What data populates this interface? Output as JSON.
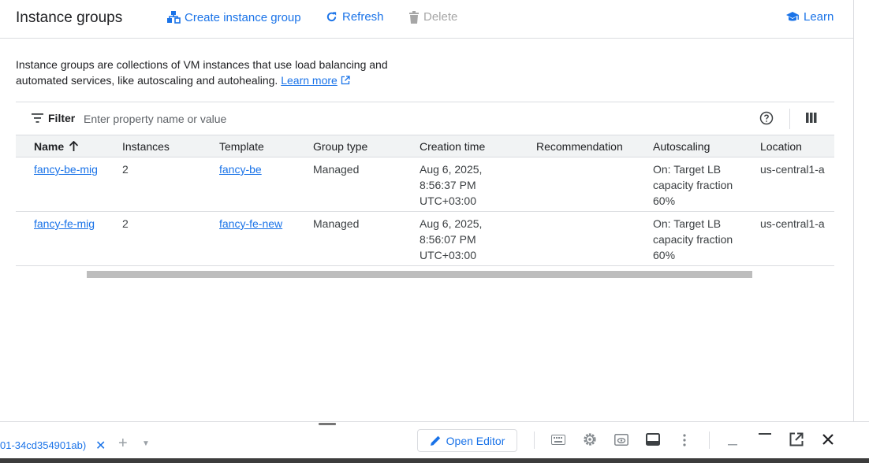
{
  "header": {
    "title": "Instance groups",
    "create_label": "Create instance group",
    "refresh_label": "Refresh",
    "delete_label": "Delete",
    "learn_label": "Learn"
  },
  "description": {
    "text": "Instance groups are collections of VM instances that use load balancing and automated services, like autoscaling and autohealing.",
    "learn_more": "Learn more"
  },
  "filter": {
    "label": "Filter",
    "placeholder": "Enter property name or value"
  },
  "table": {
    "columns": [
      "Name",
      "Instances",
      "Template",
      "Group type",
      "Creation time",
      "Recommendation",
      "Autoscaling",
      "Location"
    ],
    "rows": [
      {
        "name": "fancy-be-mig",
        "instances": "2",
        "template": "fancy-be",
        "group_type": "Managed",
        "creation_1": "Aug 6, 2025,",
        "creation_2": "8:56:37 PM",
        "creation_3": "UTC+03:00",
        "recommendation": "",
        "autoscaling_1": "On: Target LB",
        "autoscaling_2": "capacity fraction",
        "autoscaling_3": "60%",
        "location": "us-central1-a"
      },
      {
        "name": "fancy-fe-mig",
        "instances": "2",
        "template": "fancy-fe-new",
        "group_type": "Managed",
        "creation_1": "Aug 6, 2025,",
        "creation_2": "8:56:07 PM",
        "creation_3": "UTC+03:00",
        "recommendation": "",
        "autoscaling_1": "On: Target LB",
        "autoscaling_2": "capacity fraction",
        "autoscaling_3": "60%",
        "location": "us-central1-a"
      }
    ]
  },
  "shell": {
    "tab_label": "01-34cd354901ab)",
    "close_glyph": "✕",
    "plus_glyph": "+",
    "caret_glyph": "▼",
    "open_editor_label": "Open Editor"
  },
  "colors": {
    "accent": "#1a73e8",
    "border": "#dadce0",
    "header_bg": "#f1f3f4"
  },
  "icons": [
    "create-group-icon",
    "refresh-icon",
    "delete-icon",
    "learn-icon",
    "external-link-icon",
    "filter-icon",
    "help-icon",
    "column-display-icon",
    "sort-arrow-up-icon",
    "pencil-icon",
    "keyboard-icon",
    "settings-icon",
    "web-preview-icon",
    "panel-icon",
    "more-vert-icon",
    "minimize-icon",
    "maximize-icon",
    "open-new-window-icon",
    "close-icon"
  ]
}
